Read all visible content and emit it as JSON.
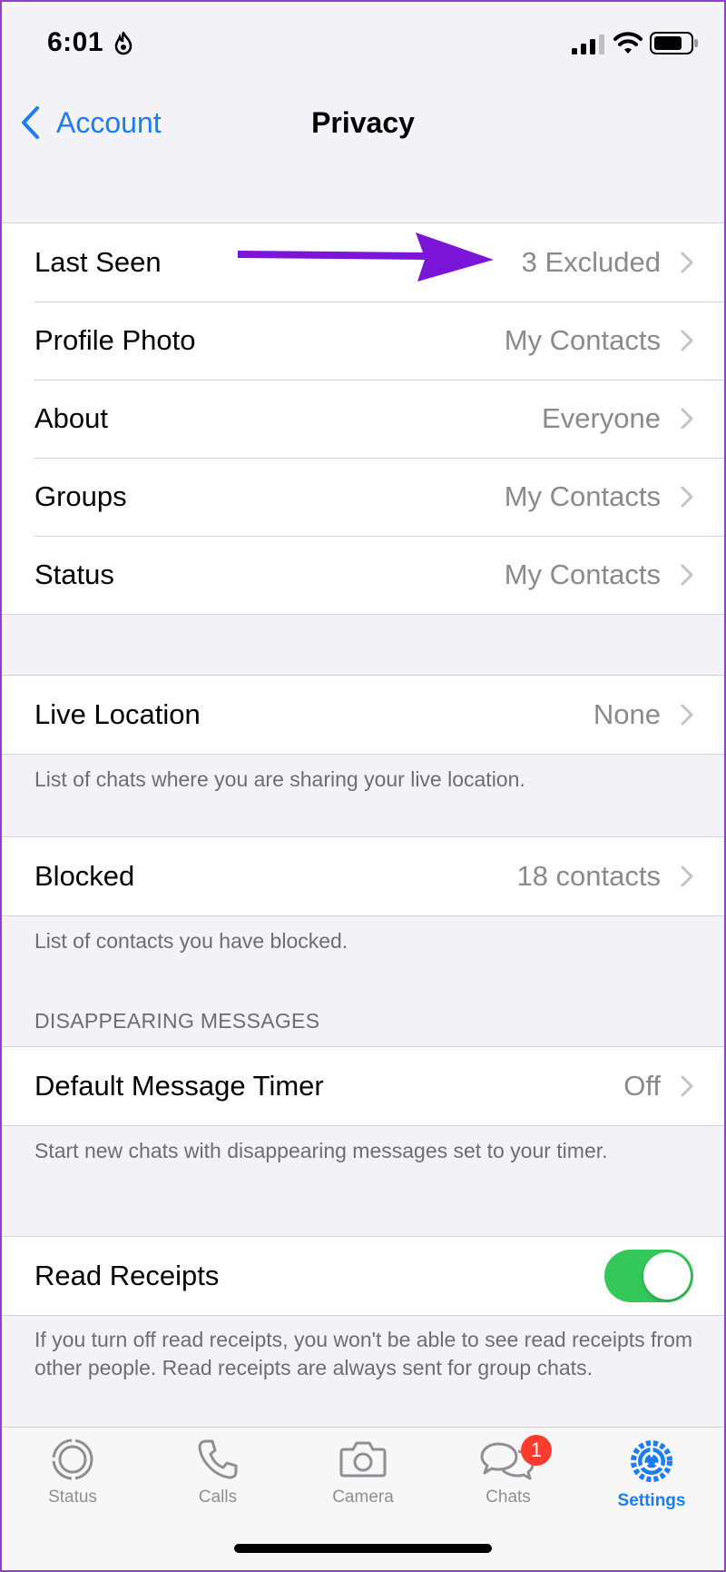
{
  "status_bar": {
    "time": "6:01"
  },
  "nav": {
    "back_label": "Account",
    "title": "Privacy"
  },
  "privacy_rows": [
    {
      "label": "Last Seen",
      "value": "3 Excluded"
    },
    {
      "label": "Profile Photo",
      "value": "My Contacts"
    },
    {
      "label": "About",
      "value": "Everyone"
    },
    {
      "label": "Groups",
      "value": "My Contacts"
    },
    {
      "label": "Status",
      "value": "My Contacts"
    }
  ],
  "live_location": {
    "label": "Live Location",
    "value": "None",
    "footnote": "List of chats where you are sharing your live location."
  },
  "blocked": {
    "label": "Blocked",
    "value": "18 contacts",
    "footnote": "List of contacts you have blocked."
  },
  "disappearing": {
    "header": "DISAPPEARING MESSAGES",
    "label": "Default Message Timer",
    "value": "Off",
    "footnote": "Start new chats with disappearing messages set to your timer."
  },
  "read_receipts": {
    "label": "Read Receipts",
    "enabled": true,
    "footnote": "If you turn off read receipts, you won't be able to see read receipts from other people. Read receipts are always sent for group chats."
  },
  "tabs": [
    {
      "label": "Status",
      "icon": "status-ring-icon"
    },
    {
      "label": "Calls",
      "icon": "phone-icon"
    },
    {
      "label": "Camera",
      "icon": "camera-icon"
    },
    {
      "label": "Chats",
      "icon": "chat-bubbles-icon",
      "badge": "1"
    },
    {
      "label": "Settings",
      "icon": "gear-icon",
      "active": true
    }
  ],
  "colors": {
    "accent": "#1e7cf2",
    "toggle_on": "#34c759",
    "badge": "#ff3b30",
    "annotation_arrow": "#7b16d9",
    "frame": "#8e3fd0"
  }
}
